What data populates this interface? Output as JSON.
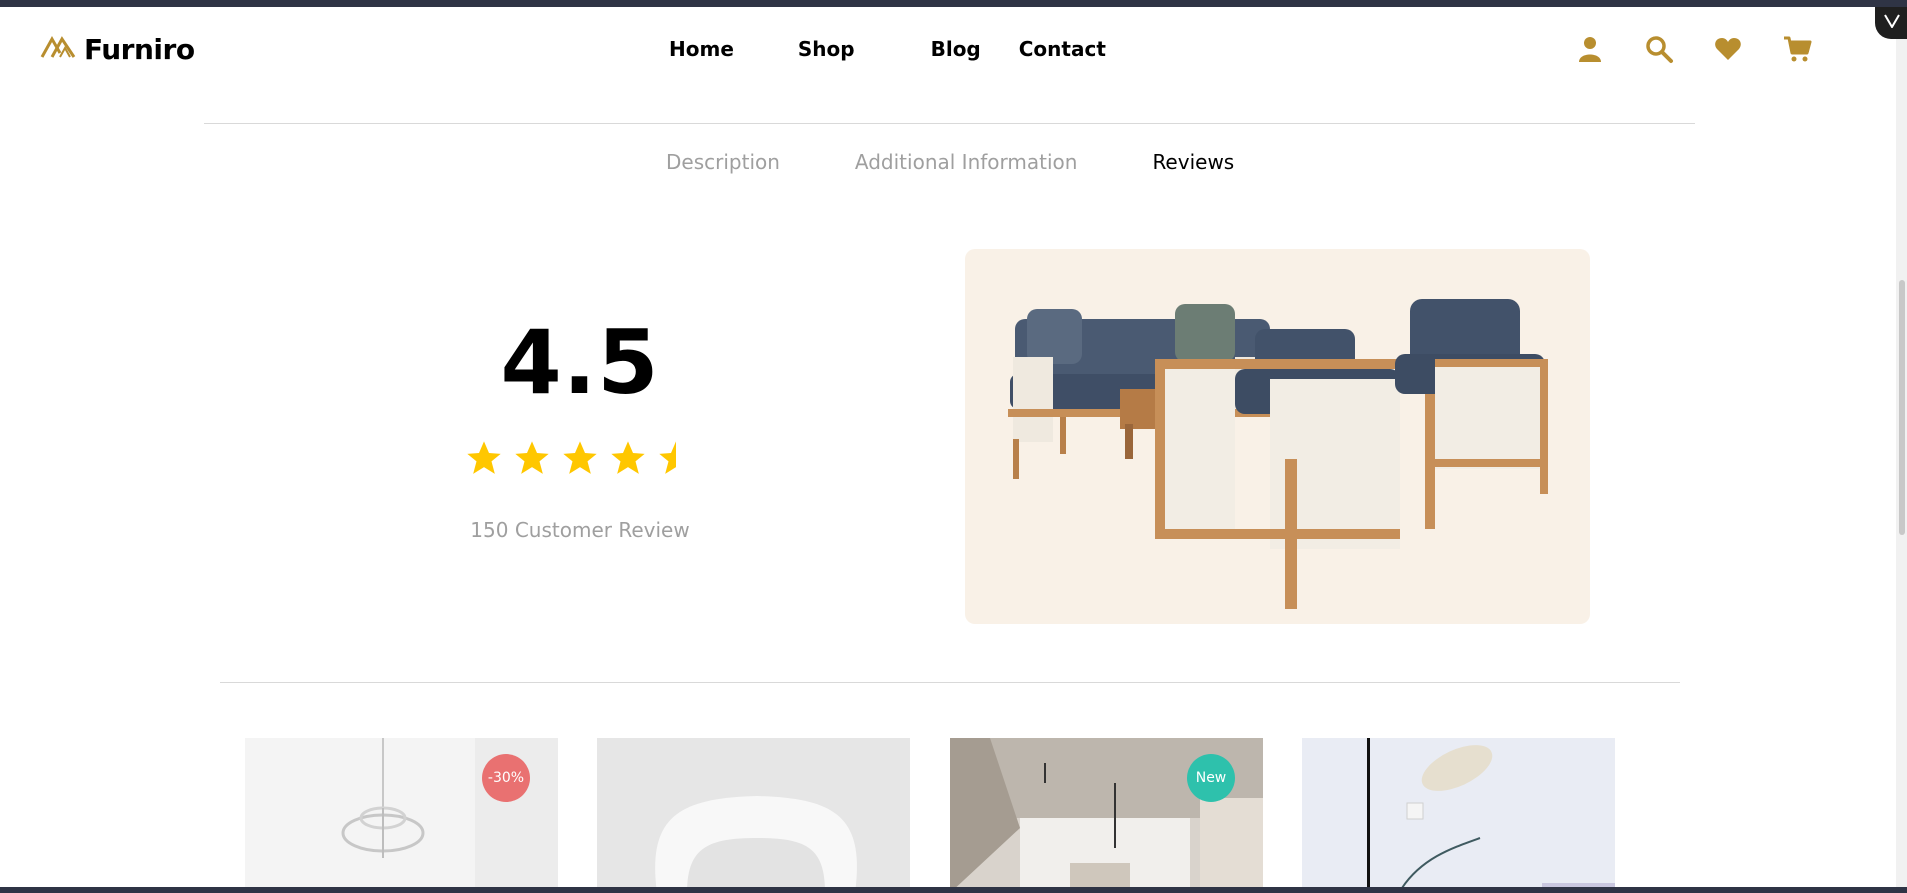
{
  "brand": {
    "name": "Furniro",
    "accent_color": "#B88E2F"
  },
  "nav": {
    "items": [
      {
        "label": "Home"
      },
      {
        "label": "Shop"
      },
      {
        "label": "Blog"
      },
      {
        "label": "Contact"
      }
    ]
  },
  "header_icons": [
    "user-icon",
    "search-icon",
    "heart-icon",
    "cart-icon"
  ],
  "tabs": [
    {
      "label": "Description",
      "active": false
    },
    {
      "label": "Additional Information",
      "active": false
    },
    {
      "label": "Reviews",
      "active": true
    }
  ],
  "reviews": {
    "rating": "4.5",
    "stars_filled": 4.5,
    "stars_total": 5,
    "star_color": "#FFC700",
    "count_text": "150 Customer Review"
  },
  "product_image": {
    "icon": "sofa-set-image",
    "background": "#F9F1E7"
  },
  "related_products": [
    {
      "badge": "-30%",
      "badge_color": "#E97171",
      "image": "chandelier-image"
    },
    {
      "badge": "",
      "image": "white-chair-image"
    },
    {
      "badge": "New",
      "badge_color": "#2EC1AC",
      "image": "room-interior-image"
    },
    {
      "badge": "",
      "image": "lamp-image"
    }
  ]
}
